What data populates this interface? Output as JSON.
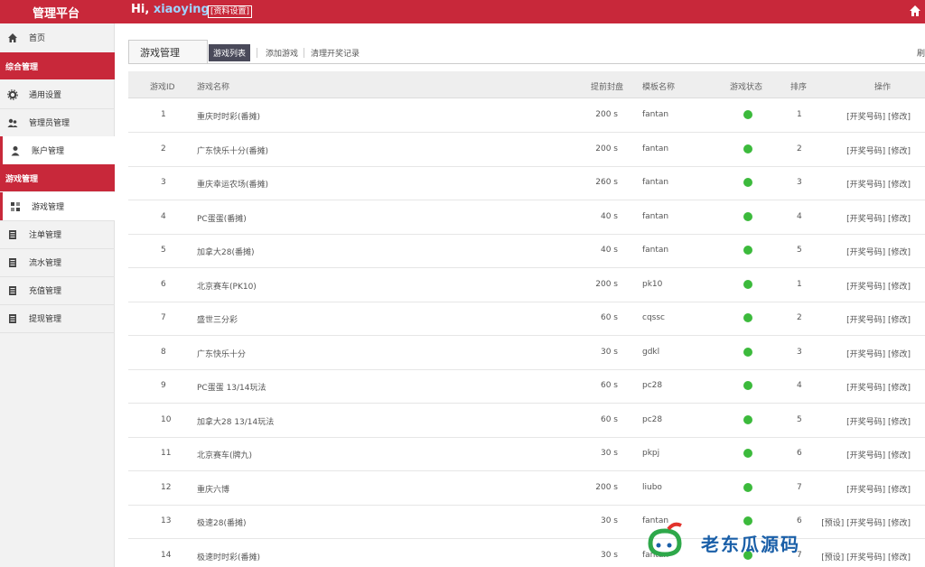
{
  "header": {
    "brand": "管理平台",
    "greeting": "Hi, ",
    "username": "xiaoying",
    "profile_link": "[资料设置]",
    "home_icon": "home-icon"
  },
  "sidebar": {
    "home": "首页",
    "section_general": "综合管理",
    "general_items": [
      {
        "label": "通用设置",
        "icon": "gear-icon"
      },
      {
        "label": "管理员管理",
        "icon": "admin-icon"
      },
      {
        "label": "账户管理",
        "icon": "user-icon"
      }
    ],
    "section_game": "游戏管理",
    "game_items": [
      {
        "label": "游戏管理",
        "icon": "game-icon"
      },
      {
        "label": "注单管理",
        "icon": "doc-icon"
      },
      {
        "label": "流水管理",
        "icon": "doc-icon"
      },
      {
        "label": "充值管理",
        "icon": "doc-icon"
      },
      {
        "label": "提现管理",
        "icon": "doc-icon"
      }
    ]
  },
  "main": {
    "page_tab": "游戏管理",
    "subtabs": [
      "游戏列表",
      "添加游戏",
      "清理开奖记录"
    ],
    "refresh": "刷",
    "columns": [
      "游戏ID",
      "游戏名称",
      "提前封盘",
      "模板名称",
      "游戏状态",
      "排序",
      "操作"
    ],
    "rows": [
      {
        "id": "1",
        "name": "重庆时时彩(番摊)",
        "close": "200 s",
        "tpl": "fantan",
        "sort": "1",
        "ops": "[开奖号码] [修改]"
      },
      {
        "id": "2",
        "name": "广东快乐十分(番摊)",
        "close": "200 s",
        "tpl": "fantan",
        "sort": "2",
        "ops": "[开奖号码] [修改]"
      },
      {
        "id": "3",
        "name": "重庆幸运农场(番摊)",
        "close": "260 s",
        "tpl": "fantan",
        "sort": "3",
        "ops": "[开奖号码] [修改]"
      },
      {
        "id": "4",
        "name": "PC蛋蛋(番摊)",
        "close": "40 s",
        "tpl": "fantan",
        "sort": "4",
        "ops": "[开奖号码] [修改]"
      },
      {
        "id": "5",
        "name": "加拿大28(番摊)",
        "close": "40 s",
        "tpl": "fantan",
        "sort": "5",
        "ops": "[开奖号码] [修改]"
      },
      {
        "id": "6",
        "name": "北京赛车(PK10)",
        "close": "200 s",
        "tpl": "pk10",
        "sort": "1",
        "ops": "[开奖号码] [修改]"
      },
      {
        "id": "7",
        "name": "盛世三分彩",
        "close": "60 s",
        "tpl": "cqssc",
        "sort": "2",
        "ops": "[开奖号码] [修改]"
      },
      {
        "id": "8",
        "name": "广东快乐十分",
        "close": "30 s",
        "tpl": "gdkl",
        "sort": "3",
        "ops": "[开奖号码] [修改]"
      },
      {
        "id": "9",
        "name": "PC蛋蛋 13/14玩法",
        "close": "60 s",
        "tpl": "pc28",
        "sort": "4",
        "ops": "[开奖号码] [修改]"
      },
      {
        "id": "10",
        "name": "加拿大28 13/14玩法",
        "close": "60 s",
        "tpl": "pc28",
        "sort": "5",
        "ops": "[开奖号码] [修改]"
      },
      {
        "id": "11",
        "name": "北京赛车(牌九)",
        "close": "30 s",
        "tpl": "pkpj",
        "sort": "6",
        "ops": "[开奖号码] [修改]"
      },
      {
        "id": "12",
        "name": "重庆六博",
        "close": "200 s",
        "tpl": "liubo",
        "sort": "7",
        "ops": "[开奖号码] [修改]"
      },
      {
        "id": "13",
        "name": "极速28(番摊)",
        "close": "30 s",
        "tpl": "fantan",
        "sort": "6",
        "ops": "[预设] [开奖号码] [修改]"
      },
      {
        "id": "14",
        "name": "极速时时彩(番摊)",
        "close": "30 s",
        "tpl": "fantan",
        "sort": "7",
        "ops": "[预设] [开奖号码] [修改]"
      }
    ]
  },
  "watermark": {
    "text": "老东瓜源码",
    "icon": "watermark-logo-icon"
  },
  "colors": {
    "brand_red": "#c8283a",
    "status_green": "#3cba3c",
    "watermark_blue": "#1a5fa8"
  }
}
